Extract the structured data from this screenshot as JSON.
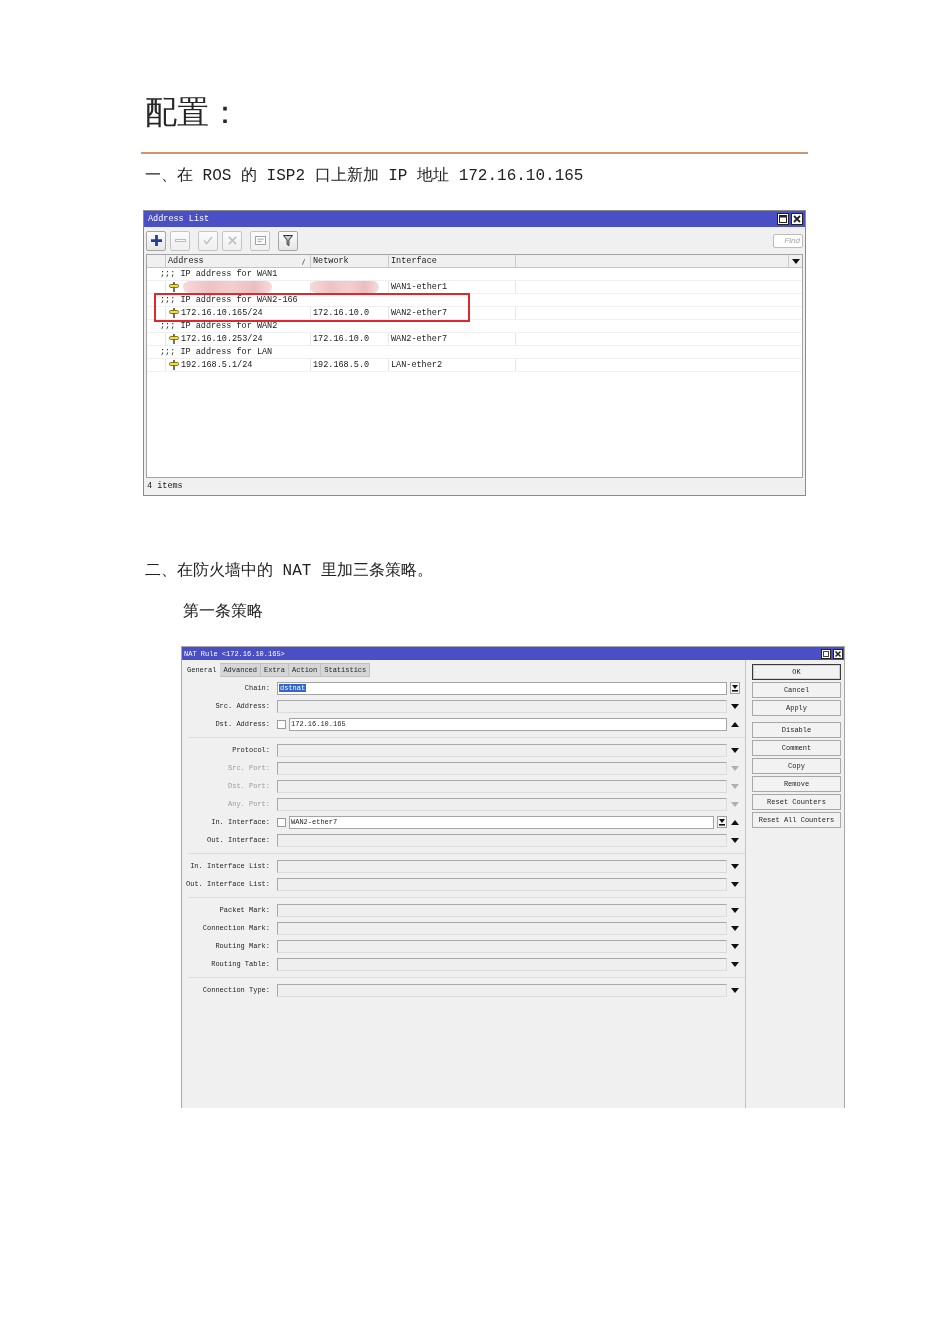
{
  "heading": "配置：",
  "step_1": {
    "text": "一、在 ROS 的 ISP2 口上新加 IP 地址 172.16.10.165"
  },
  "address_list": {
    "title": "Address List",
    "toolbar": [
      {
        "kind": "add",
        "disabled": false
      },
      {
        "kind": "remove",
        "disabled": true
      },
      {
        "kind": "enable",
        "disabled": true
      },
      {
        "kind": "disable",
        "disabled": true
      },
      {
        "kind": "comment",
        "disabled": true
      },
      {
        "kind": "filter",
        "disabled": false
      }
    ],
    "find": {
      "placeholder": "Find"
    },
    "columns": [
      {
        "label": "Address",
        "sorted": true
      },
      {
        "label": "Network",
        "sorted": false
      },
      {
        "label": "Interface",
        "sorted": false
      }
    ],
    "rows": [
      {
        "kind": "comment",
        "text": ";;; IP address for WAN1",
        "highlighted": false
      },
      {
        "kind": "address",
        "redacted": true,
        "interface": "WAN1-ether1",
        "highlighted": false
      },
      {
        "kind": "comment",
        "text": ";;; IP address for WAN2-166",
        "highlighted": true
      },
      {
        "kind": "address",
        "redacted": false,
        "address": "172.16.10.165/24",
        "network": "172.16.10.0",
        "interface": "WAN2-ether7",
        "highlighted": true
      },
      {
        "kind": "comment",
        "text": ";;; IP address for WAN2",
        "highlighted": false
      },
      {
        "kind": "address",
        "redacted": false,
        "address": "172.16.10.253/24",
        "network": "172.16.10.0",
        "interface": "WAN2-ether7",
        "highlighted": false
      },
      {
        "kind": "comment",
        "text": ";;; IP address for LAN",
        "highlighted": false
      },
      {
        "kind": "address",
        "redacted": false,
        "address": "192.168.5.1/24",
        "network": "192.168.5.0",
        "interface": "LAN-ether2",
        "highlighted": false
      }
    ],
    "status": "4 items"
  },
  "step_2": {
    "text": "二、在防火墙中的 NAT 里加三条策略。",
    "subheading": "第一条策略"
  },
  "nat_rule": {
    "title": "NAT Rule <172.16.10.165>",
    "tabs": [
      {
        "label": "General",
        "selected": true
      },
      {
        "label": "Advanced",
        "selected": false
      },
      {
        "label": "Extra",
        "selected": false
      },
      {
        "label": "Action",
        "selected": false
      },
      {
        "label": "Statistics",
        "selected": false
      }
    ],
    "field_groups": [
      {
        "fields": [
          {
            "kind": "combo",
            "label": "Chain:",
            "value": "dstnat",
            "highlighted": true,
            "disabled": false
          },
          {
            "kind": "collapsed",
            "label": "Src. Address:",
            "disabled": false
          },
          {
            "kind": "expanded",
            "label": "Dst. Address:",
            "checked": false,
            "value": "172.16.10.165",
            "highlighted": false,
            "disabled": false
          }
        ]
      },
      {
        "fields": [
          {
            "kind": "collapsed",
            "label": "Protocol:",
            "disabled": false
          },
          {
            "kind": "collapsed",
            "label": "Src. Port:",
            "disabled": true
          },
          {
            "kind": "collapsed",
            "label": "Dst. Port:",
            "disabled": true
          },
          {
            "kind": "collapsed",
            "label": "Any. Port:",
            "disabled": true
          },
          {
            "kind": "expanded-combo",
            "label": "In. Interface:",
            "checked": false,
            "value": "WAN2-ether7",
            "highlighted": false,
            "disabled": false
          },
          {
            "kind": "collapsed",
            "label": "Out. Interface:",
            "disabled": false
          }
        ]
      },
      {
        "fields": [
          {
            "kind": "collapsed",
            "label": "In. Interface List:",
            "disabled": false
          },
          {
            "kind": "collapsed",
            "label": "Out. Interface List:",
            "disabled": false
          }
        ]
      },
      {
        "fields": [
          {
            "kind": "collapsed",
            "label": "Packet Mark:",
            "disabled": false
          },
          {
            "kind": "collapsed",
            "label": "Connection Mark:",
            "disabled": false
          },
          {
            "kind": "collapsed",
            "label": "Routing Mark:",
            "disabled": false
          },
          {
            "kind": "collapsed",
            "label": "Routing Table:",
            "disabled": false
          }
        ]
      },
      {
        "fields": [
          {
            "kind": "collapsed",
            "label": "Connection Type:",
            "disabled": false
          }
        ]
      }
    ],
    "button_groups": [
      {
        "buttons": [
          {
            "label": "OK",
            "default": true
          },
          {
            "label": "Cancel",
            "default": false
          },
          {
            "label": "Apply",
            "default": false
          }
        ]
      },
      {
        "buttons": [
          {
            "label": "Disable",
            "default": false
          },
          {
            "label": "Comment",
            "default": false
          },
          {
            "label": "Copy",
            "default": false
          },
          {
            "label": "Remove",
            "default": false
          },
          {
            "label": "Reset Counters",
            "default": false
          },
          {
            "label": "Reset All Counters",
            "default": false
          }
        ]
      }
    ]
  }
}
